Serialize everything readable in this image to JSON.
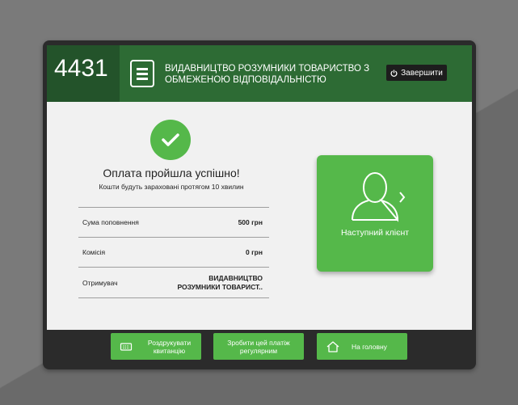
{
  "kiosk": {
    "number": "4431"
  },
  "header": {
    "company": "ВИДАВНИЦТВО РОЗУМНИКИ ТОВАРИСТВО З ОБМЕЖЕНОЮ ВІДПОВІДАЛЬНІСТЮ",
    "finish_label": "Завершити",
    "icon": "document-icon"
  },
  "status": {
    "icon": "check-icon",
    "title": "Оплата пройшла успішно!",
    "subtitle": "Кошти будуть зараховані протягом 10 хвилин"
  },
  "details": [
    {
      "label": "Сума поповнення",
      "value": "500 грн"
    },
    {
      "label": "Комісія",
      "value": "0 грн"
    },
    {
      "label": "Отримувач",
      "value": "ВИДАВНИЦТВО РОЗУМНИКИ ТОВАРИСТ.."
    }
  ],
  "next_client": {
    "label": "Наступний клієнт",
    "icon": "user-next-icon"
  },
  "footer": {
    "print_label": "Роздрукувати квитанцію",
    "regular_label": "Зробити цей платіж регулярним",
    "home_label": "На головну"
  },
  "colors": {
    "accent": "#55b84a",
    "header": "#2d6b34",
    "header_dark": "#23532a"
  }
}
